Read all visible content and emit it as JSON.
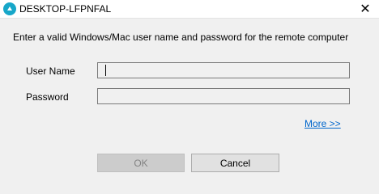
{
  "window": {
    "title": "DESKTOP-LFPNFAL",
    "app_icon": "remote-desktop-icon",
    "close_glyph": "✕"
  },
  "dialog": {
    "instruction": "Enter a valid Windows/Mac user name and password for the remote computer",
    "username_label": "User Name",
    "username_value": "",
    "password_label": "Password",
    "password_value": "",
    "more_link": "More >>",
    "ok_label": "OK",
    "ok_enabled": false,
    "cancel_label": "Cancel"
  },
  "colors": {
    "app_icon": "#17a7c9",
    "link": "#0066cc",
    "background": "#f0f0f0"
  }
}
